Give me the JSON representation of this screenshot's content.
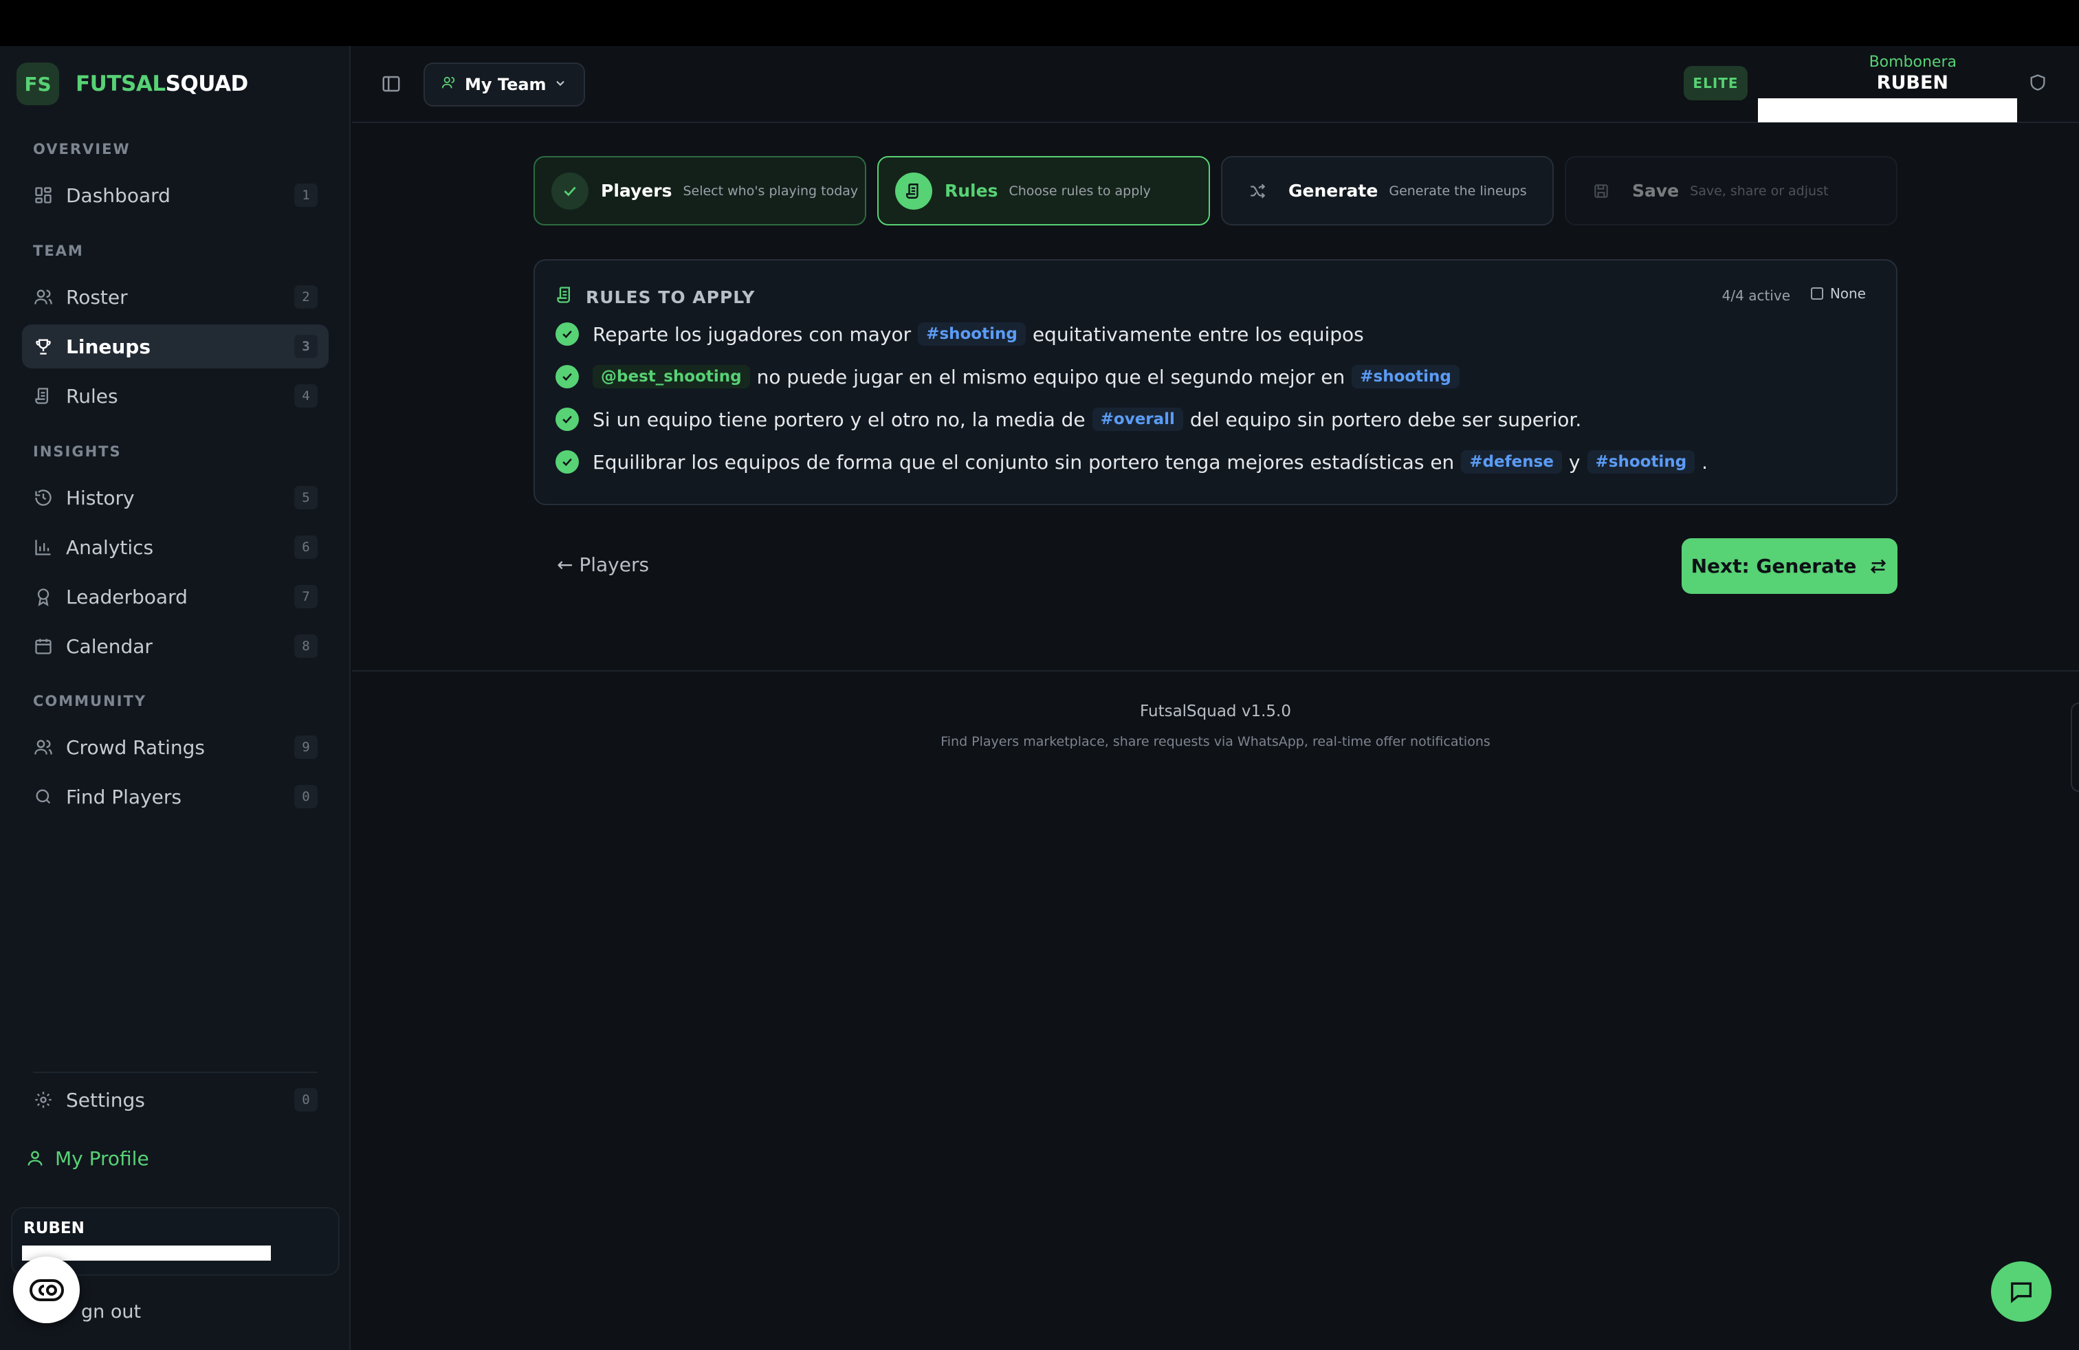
{
  "app": {
    "brand_initials": "FS",
    "brand_part1": "FUTSAL",
    "brand_part2": "SQUAD"
  },
  "sidebar": {
    "sections": {
      "overview": "OVERVIEW",
      "team": "TEAM",
      "insights": "INSIGHTS",
      "community": "COMMUNITY"
    },
    "items": [
      {
        "label": "Dashboard",
        "key": "1",
        "icon": "dashboard-icon"
      },
      {
        "label": "Roster",
        "key": "2",
        "icon": "users-icon"
      },
      {
        "label": "Lineups",
        "key": "3",
        "icon": "trophy-icon",
        "active": true
      },
      {
        "label": "Rules",
        "key": "4",
        "icon": "scroll-icon"
      },
      {
        "label": "History",
        "key": "5",
        "icon": "history-icon"
      },
      {
        "label": "Analytics",
        "key": "6",
        "icon": "bar-chart-icon"
      },
      {
        "label": "Leaderboard",
        "key": "7",
        "icon": "award-icon"
      },
      {
        "label": "Calendar",
        "key": "8",
        "icon": "calendar-icon"
      },
      {
        "label": "Crowd Ratings",
        "key": "9",
        "icon": "users-icon"
      },
      {
        "label": "Find Players",
        "key": "0",
        "icon": "search-icon"
      }
    ],
    "settings": {
      "label": "Settings",
      "key": "0"
    },
    "my_profile": "My Profile",
    "profile_name": "RUBEN",
    "sign_out": "gn out"
  },
  "header": {
    "team_select": "My Team",
    "plan_badge": "ELITE",
    "club": "Bombonera",
    "user": "RUBEN"
  },
  "stepper": [
    {
      "title": "Players",
      "subtitle": "Select who's playing today",
      "state": "done"
    },
    {
      "title": "Rules",
      "subtitle": "Choose rules to apply",
      "state": "current"
    },
    {
      "title": "Generate",
      "subtitle": "Generate the lineups",
      "state": "upcoming"
    },
    {
      "title": "Save",
      "subtitle": "Save, share or adjust",
      "state": "disabled"
    }
  ],
  "rules_panel": {
    "title": "RULES TO APPLY",
    "active_count": "4/4 active",
    "none_label": "None",
    "rules": [
      {
        "pre": "Reparte los jugadores con mayor",
        "tag1": "#shooting",
        "mid": "equitativamente entre los equipos"
      },
      {
        "tag1": "@best_shooting",
        "mid": "no puede jugar en el mismo equipo que el segundo mejor en",
        "tag2": "#shooting"
      },
      {
        "pre": "Si un equipo tiene portero y el otro no, la media de",
        "tag1": "#overall",
        "mid": "del equipo sin portero debe ser superior."
      },
      {
        "pre": "Equilibrar los equipos de forma que el conjunto sin portero tenga mejores estadísticas en",
        "tag1": "#defense",
        "mid": "y",
        "tag2": "#shooting",
        "post": "."
      }
    ]
  },
  "nav": {
    "back": "← Players",
    "next": "Next: Generate"
  },
  "footer": {
    "version": "FutsalSquad v1.5.0",
    "note": "Find Players marketplace, share requests via WhatsApp, real-time offer notifications"
  },
  "colors": {
    "accent": "#57d275",
    "tag_blue": "#5b9cf5",
    "background": "#0e1116"
  }
}
